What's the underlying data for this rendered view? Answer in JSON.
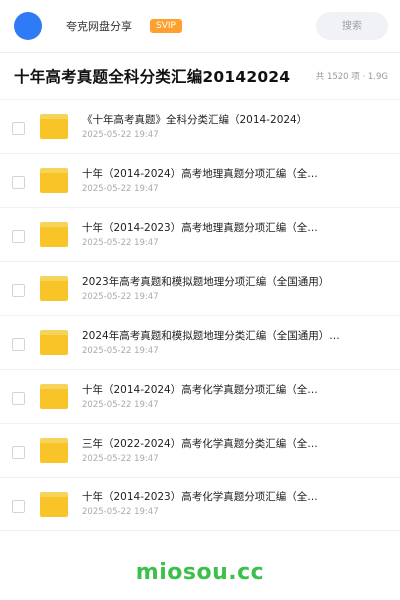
{
  "header": {
    "app_name": "夸克网盘分享",
    "badge": "SVIP",
    "search_placeholder": "搜索"
  },
  "title": {
    "text": "十年高考真题全科分类汇编20142024",
    "meta": "共 1520 项 · 1.9G"
  },
  "files": [
    {
      "name": "《十年高考真题》全科分类汇编（2014-2024）",
      "date": "2025-05-22 19:47",
      "icon": "folder-icon"
    },
    {
      "name": "十年（2014-2024）高考地理真题分项汇编（全…",
      "date": "2025-05-22 19:47",
      "icon": "folder-icon"
    },
    {
      "name": "十年（2014-2023）高考地理真题分项汇编（全…",
      "date": "2025-05-22 19:47",
      "icon": "folder-icon"
    },
    {
      "name": "2023年高考真题和模拟题地理分项汇编（全国通用）",
      "date": "2025-05-22 19:47",
      "icon": "folder-icon"
    },
    {
      "name": "2024年高考真题和模拟题地理分类汇编（全国通用）…",
      "date": "2025-05-22 19:47",
      "icon": "folder-icon"
    },
    {
      "name": "十年（2014-2024）高考化学真题分项汇编（全…",
      "date": "2025-05-22 19:47",
      "icon": "folder-icon"
    },
    {
      "name": "三年（2022-2024）高考化学真题分类汇编（全…",
      "date": "2025-05-22 19:47",
      "icon": "folder-icon"
    },
    {
      "name": "十年（2014-2023）高考化学真题分项汇编（全…",
      "date": "2025-05-22 19:47",
      "icon": "folder-icon"
    }
  ],
  "watermark": "miosou.cc",
  "colors": {
    "avatar": "#2f7bf5",
    "svip_badge": "#ff9f2e",
    "folder": "#f9c427",
    "watermark": "#3cc04a"
  }
}
